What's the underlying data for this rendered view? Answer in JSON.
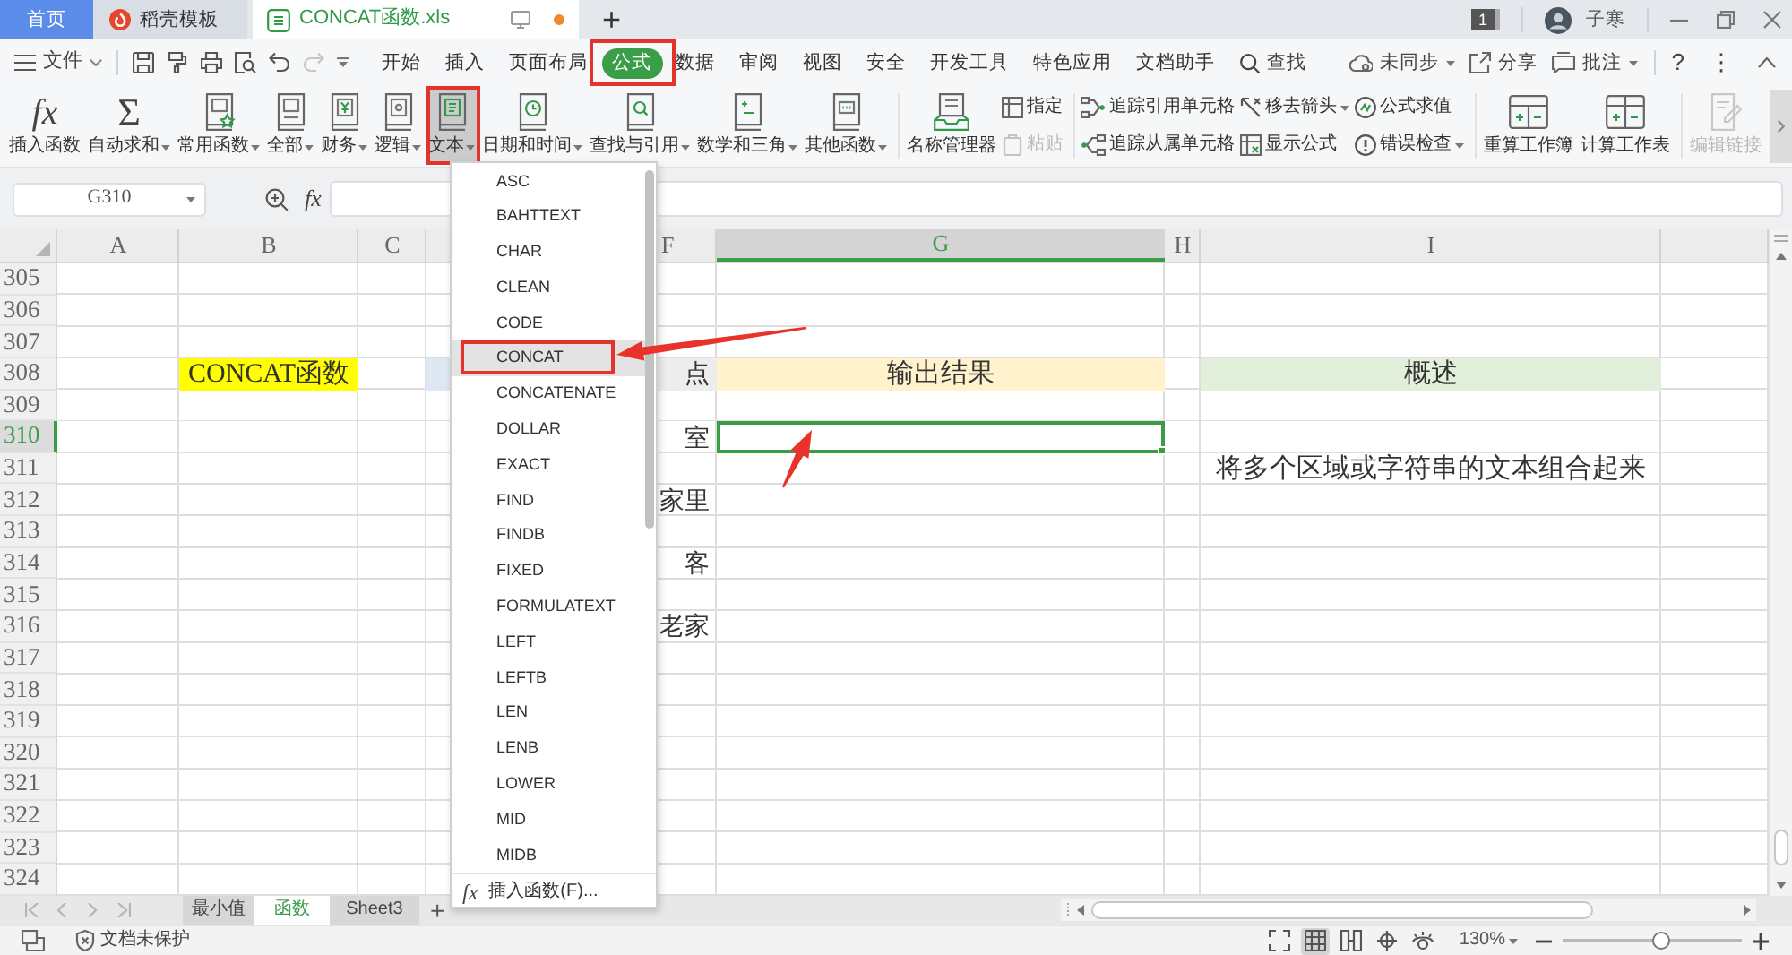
{
  "title_bar": {
    "tabs": [
      {
        "kind": "home",
        "label": "首页",
        "selected": false
      },
      {
        "kind": "template",
        "label": "稻壳模板",
        "selected": false
      },
      {
        "kind": "document",
        "label": "CONCAT函数.xls",
        "selected": true,
        "unsaved": true
      }
    ],
    "new_tab": "+",
    "notification_count": "1",
    "user_name": "子寒"
  },
  "menu_bar": {
    "file_menu": "文件",
    "quick_access": [
      {
        "disabled": false
      },
      {
        "disabled": false
      },
      {
        "disabled": false
      },
      {
        "disabled": false
      },
      {
        "disabled": false
      },
      {
        "disabled": true
      }
    ],
    "tabs": [
      {
        "label": "开始",
        "selected": false,
        "highlighted": false
      },
      {
        "label": "插入",
        "selected": false,
        "highlighted": false
      },
      {
        "label": "页面布局",
        "selected": false,
        "highlighted": false
      },
      {
        "label": "公式",
        "selected": true,
        "highlighted": true
      },
      {
        "label": "数据",
        "selected": false,
        "highlighted": false
      },
      {
        "label": "审阅",
        "selected": false,
        "highlighted": false
      },
      {
        "label": "视图",
        "selected": false,
        "highlighted": false
      },
      {
        "label": "安全",
        "selected": false,
        "highlighted": false
      },
      {
        "label": "开发工具",
        "selected": false,
        "highlighted": false
      },
      {
        "label": "特色应用",
        "selected": false,
        "highlighted": false
      },
      {
        "label": "文档助手",
        "selected": false,
        "highlighted": false
      }
    ],
    "search": "查找",
    "sync_status": "未同步",
    "share": "分享",
    "comments": "批注",
    "help": "?",
    "more": "⋮"
  },
  "ribbon": {
    "groups": [
      {
        "items": [
          {
            "kind": "glyph",
            "glyph": "fx",
            "label": "插入函数",
            "dropdown": false,
            "expanded": false,
            "highlighted": false
          },
          {
            "kind": "glyph",
            "glyph": "Σ",
            "label": "自动求和",
            "dropdown": true,
            "expanded": false,
            "highlighted": false
          },
          {
            "kind": "large",
            "label": "常用函数",
            "dropdown": true,
            "expanded": false,
            "highlighted": false
          },
          {
            "kind": "large",
            "label": "全部",
            "dropdown": true,
            "expanded": false,
            "highlighted": false
          },
          {
            "kind": "large",
            "label": "财务",
            "dropdown": true,
            "expanded": false,
            "highlighted": false
          },
          {
            "kind": "large",
            "label": "逻辑",
            "dropdown": true,
            "expanded": false,
            "highlighted": false
          },
          {
            "kind": "large",
            "label": "文本",
            "dropdown": true,
            "expanded": true,
            "highlighted": true
          },
          {
            "kind": "large",
            "label": "日期和时间",
            "dropdown": true,
            "expanded": false,
            "highlighted": false
          },
          {
            "kind": "large",
            "label": "查找与引用",
            "dropdown": true,
            "expanded": false,
            "highlighted": false
          },
          {
            "kind": "large",
            "label": "数学和三角",
            "dropdown": true,
            "expanded": false,
            "highlighted": false
          },
          {
            "kind": "large",
            "label": "其他函数",
            "dropdown": true,
            "expanded": false,
            "highlighted": false
          }
        ]
      },
      {
        "items": [
          {
            "kind": "large",
            "label": "名称管理器",
            "disabled": false
          },
          {
            "kind": "small",
            "label": "指定",
            "disabled": false
          },
          {
            "kind": "small",
            "label": "粘贴",
            "disabled": true
          }
        ]
      },
      {
        "items": [
          {
            "kind": "small",
            "label": "追踪引用单元格",
            "dropdown": false
          },
          {
            "kind": "small",
            "label": "追踪从属单元格",
            "dropdown": false
          },
          {
            "kind": "small",
            "label": "移去箭头",
            "dropdown": true
          },
          {
            "kind": "small",
            "label": "显示公式",
            "dropdown": false
          },
          {
            "kind": "small",
            "label": "公式求值",
            "dropdown": false
          },
          {
            "kind": "small",
            "label": "错误检查",
            "dropdown": true
          }
        ]
      },
      {
        "items": [
          {
            "kind": "large",
            "label": "重算工作簿"
          },
          {
            "kind": "large",
            "label": "计算工作表"
          }
        ]
      },
      {
        "items": [
          {
            "kind": "large",
            "label": "编辑链接",
            "disabled": true
          }
        ]
      }
    ]
  },
  "formula_bar": {
    "name_box": "G310",
    "fx": "fx"
  },
  "sheet": {
    "columns": [
      {
        "label": "A",
        "selected": false
      },
      {
        "label": "B",
        "selected": false
      },
      {
        "label": "C",
        "selected": false
      },
      {
        "label": "F",
        "selected": false
      },
      {
        "label": "G",
        "selected": true
      },
      {
        "label": "H",
        "selected": false
      },
      {
        "label": "I",
        "selected": false
      }
    ],
    "rows": [
      {
        "number": "305",
        "selected": false
      },
      {
        "number": "306",
        "selected": false
      },
      {
        "number": "307",
        "selected": false
      },
      {
        "number": "308",
        "selected": false,
        "cells": {
          "B": {
            "text": "CONCAT函数",
            "color": "#ffff00",
            "selected": false
          },
          "D": {
            "color": "#dde8f3",
            "selected": false
          },
          "F": {
            "text": "点",
            "color": "#ededed",
            "selected": false
          },
          "G": {
            "text": "输出结果",
            "color": "#fff2cc",
            "selected": false
          },
          "I": {
            "text": "概述",
            "color": "#e2efda",
            "selected": false
          }
        }
      },
      {
        "number": "309",
        "selected": false
      },
      {
        "number": "310",
        "selected": true,
        "cells": {
          "F": {
            "text": "室",
            "selected": false
          },
          "G": {
            "selected": true
          }
        }
      },
      {
        "number": "311",
        "selected": false,
        "cells": {
          "I": {
            "text": "将多个区域或字符串的文本组合起来",
            "selected": false
          }
        }
      },
      {
        "number": "312",
        "selected": false,
        "cells": {
          "F": {
            "text": "家里",
            "selected": false
          }
        }
      },
      {
        "number": "313",
        "selected": false
      },
      {
        "number": "314",
        "selected": false,
        "cells": {
          "F": {
            "text": "客",
            "selected": false
          }
        }
      },
      {
        "number": "315",
        "selected": false
      },
      {
        "number": "316",
        "selected": false,
        "cells": {
          "F": {
            "text": "老家",
            "selected": false
          }
        }
      },
      {
        "number": "317",
        "selected": false
      },
      {
        "number": "318",
        "selected": false
      },
      {
        "number": "319",
        "selected": false
      },
      {
        "number": "320",
        "selected": false
      },
      {
        "number": "321",
        "selected": false
      },
      {
        "number": "322",
        "selected": false
      },
      {
        "number": "323",
        "selected": false
      },
      {
        "number": "324",
        "selected": false
      }
    ]
  },
  "function_menu": {
    "items": [
      {
        "label": "ASC",
        "selected": false,
        "highlighted": false
      },
      {
        "label": "BAHTTEXT",
        "selected": false,
        "highlighted": false
      },
      {
        "label": "CHAR",
        "selected": false,
        "highlighted": false
      },
      {
        "label": "CLEAN",
        "selected": false,
        "highlighted": false
      },
      {
        "label": "CODE",
        "selected": false,
        "highlighted": false
      },
      {
        "label": "CONCAT",
        "selected": true,
        "highlighted": true
      },
      {
        "label": "CONCATENATE",
        "selected": false,
        "highlighted": false
      },
      {
        "label": "DOLLAR",
        "selected": false,
        "highlighted": false
      },
      {
        "label": "EXACT",
        "selected": false,
        "highlighted": false
      },
      {
        "label": "FIND",
        "selected": false,
        "highlighted": false
      },
      {
        "label": "FINDB",
        "selected": false,
        "highlighted": false
      },
      {
        "label": "FIXED",
        "selected": false,
        "highlighted": false
      },
      {
        "label": "FORMULATEXT",
        "selected": false,
        "highlighted": false
      },
      {
        "label": "LEFT",
        "selected": false,
        "highlighted": false
      },
      {
        "label": "LEFTB",
        "selected": false,
        "highlighted": false
      },
      {
        "label": "LEN",
        "selected": false,
        "highlighted": false
      },
      {
        "label": "LENB",
        "selected": false,
        "highlighted": false
      },
      {
        "label": "LOWER",
        "selected": false,
        "highlighted": false
      },
      {
        "label": "MID",
        "selected": false,
        "highlighted": false
      },
      {
        "label": "MIDB",
        "selected": false,
        "highlighted": false
      }
    ],
    "footer": {
      "glyph": "fx",
      "label": "插入函数(F)..."
    }
  },
  "sheet_tabs": {
    "tabs": [
      {
        "label": "最小值",
        "selected": false
      },
      {
        "label": "函数",
        "selected": true
      },
      {
        "label": "Sheet3",
        "selected": false
      }
    ],
    "add": "+"
  },
  "status_bar": {
    "protection": "文档未保护",
    "view_modes": [
      {
        "selected": false
      },
      {
        "selected": true
      },
      {
        "selected": false
      },
      {
        "selected": false
      },
      {
        "selected": false
      }
    ],
    "zoom": "130%",
    "zoom_slider": {
      "level": 0.55
    }
  }
}
